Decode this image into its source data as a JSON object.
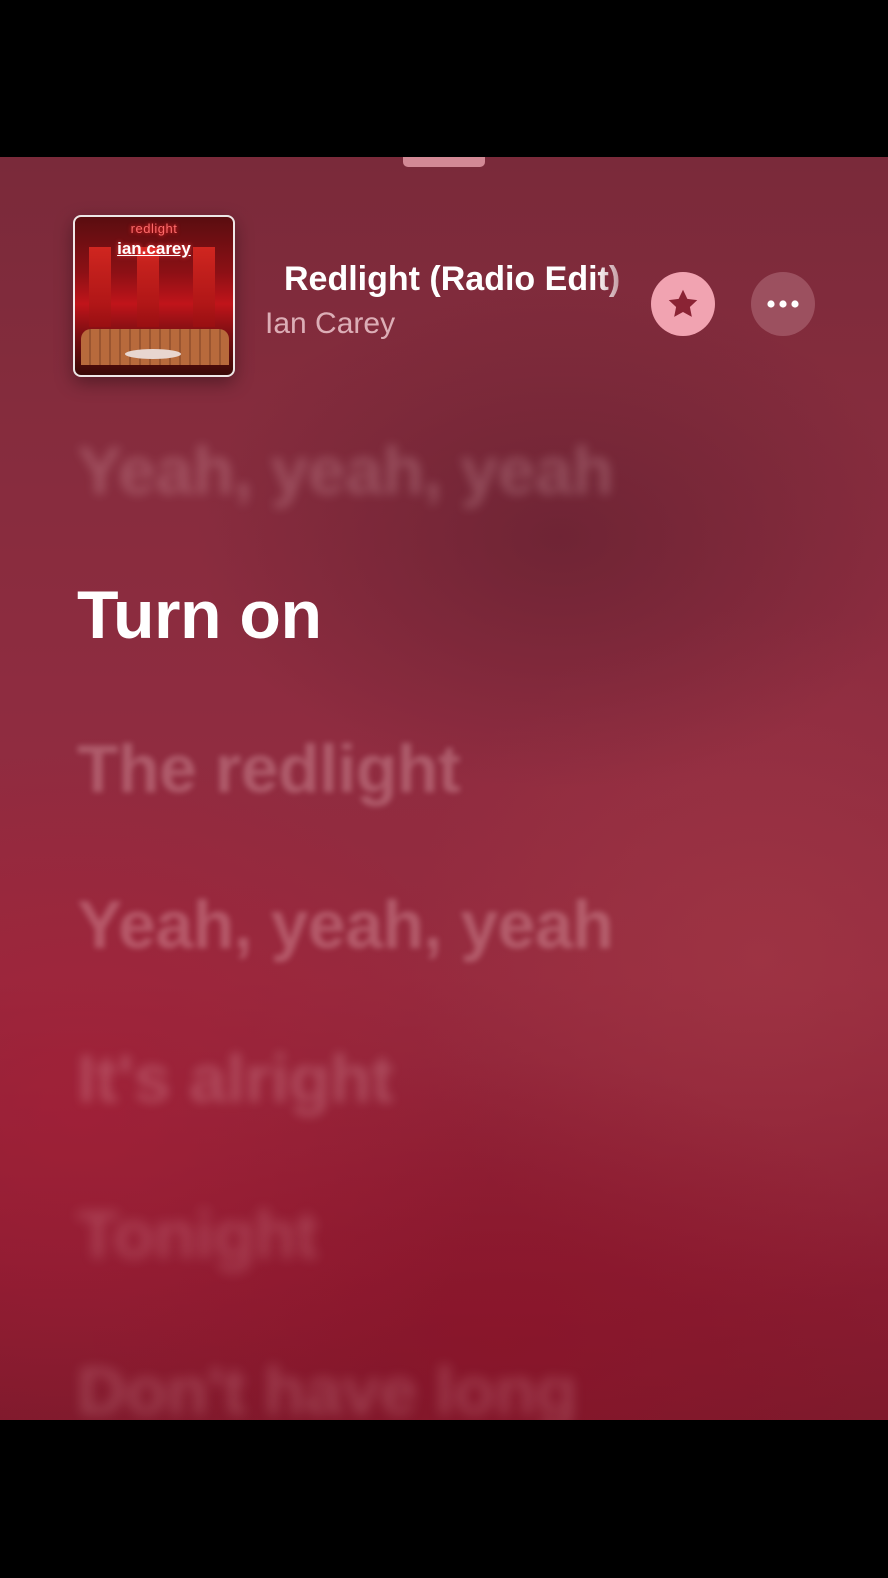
{
  "now_playing": {
    "title": "Redlight (Radio Edit)",
    "artist": "Ian Carey",
    "artwork": {
      "top_text": "redlight",
      "title_text": "ian.carey"
    }
  },
  "controls": {
    "favorite_icon": "star-icon",
    "more_icon": "ellipsis-icon"
  },
  "lyrics": {
    "previous": "Yeah, yeah, yeah",
    "current": "Turn on",
    "upcoming": [
      "The redlight",
      "Yeah, yeah, yeah",
      "It's alright",
      "Tonight",
      "Don't have long"
    ]
  },
  "colors": {
    "background": "#8f2c40",
    "star_button": "#f1a3b1",
    "star_glyph": "#8a2334",
    "active_lyric": "#ffffff"
  }
}
